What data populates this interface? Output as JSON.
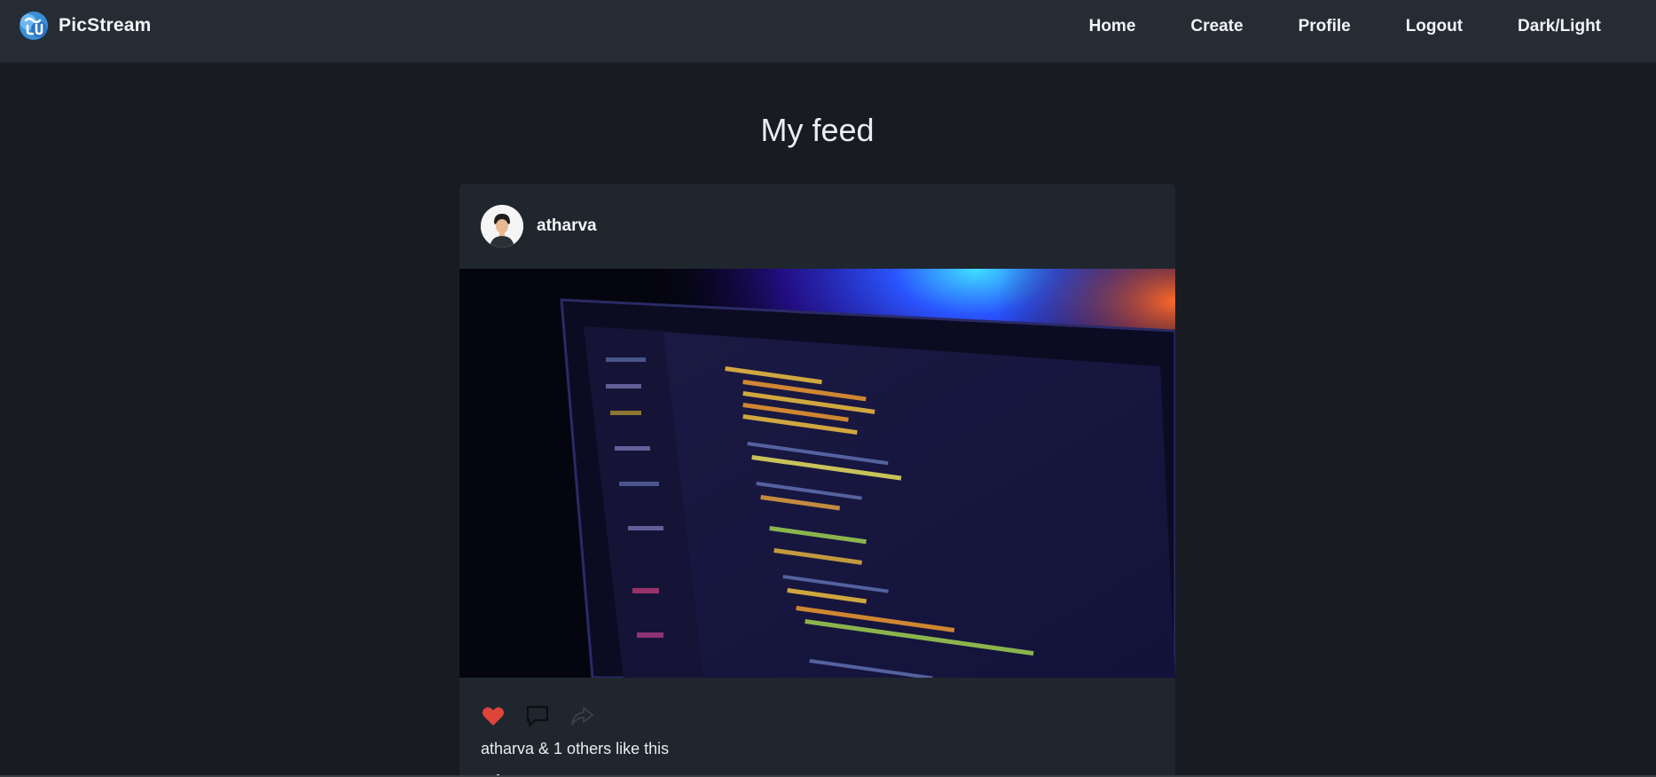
{
  "brand": {
    "name": "PicStream",
    "logo_icon": "picstream-logo-icon"
  },
  "nav": {
    "items": [
      {
        "label": "Home"
      },
      {
        "label": "Create"
      },
      {
        "label": "Profile"
      },
      {
        "label": "Logout"
      },
      {
        "label": "Dark/Light"
      }
    ]
  },
  "page": {
    "title": "My feed"
  },
  "post": {
    "username": "atharva",
    "avatar_icon": "user-avatar",
    "image_description_icon": "laptop-code-photo",
    "actions": [
      {
        "name": "like",
        "icon": "heart-icon",
        "color": "#e0433a"
      },
      {
        "name": "comment",
        "icon": "comment-icon"
      },
      {
        "name": "share",
        "icon": "share-icon"
      }
    ],
    "likes_text": "atharva & 1 others like this",
    "caption_user": "atharva"
  },
  "colors": {
    "background": "#181b21",
    "navbar": "#262c34",
    "card": "#20262e",
    "like_red": "#e0433a"
  }
}
